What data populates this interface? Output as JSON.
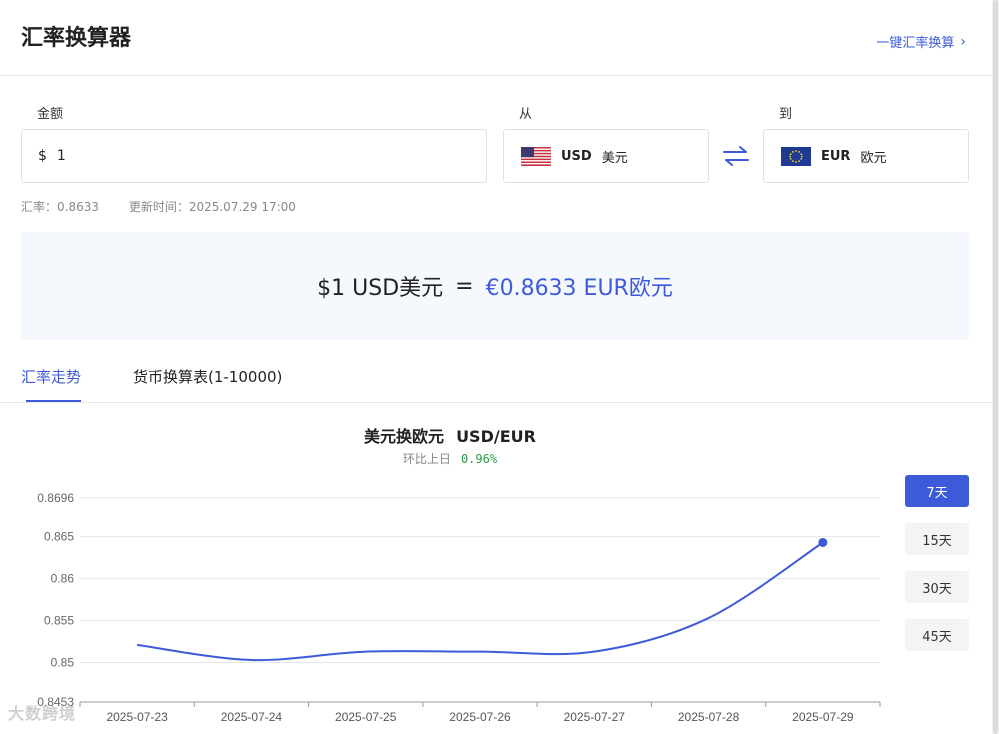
{
  "header": {
    "title": "汇率换算器",
    "quick_link": "一键汇率换算"
  },
  "converter": {
    "amount_label": "金额",
    "from_label": "从",
    "to_label": "到",
    "amount_symbol": "$",
    "amount_value": "1",
    "from": {
      "code": "USD",
      "name": "美元",
      "flag": "us-flag-icon"
    },
    "to": {
      "code": "EUR",
      "name": "欧元",
      "flag": "eu-flag-icon"
    },
    "rate_text": "汇率：0.8633",
    "update_text": "更新时间：2025.07.29 17:00"
  },
  "result": {
    "left": "$1 USD美元",
    "equals": "=",
    "right": "€0.8633 EUR欧元"
  },
  "tabs": [
    {
      "label": "汇率走势",
      "active": true
    },
    {
      "label": "货币换算表(1-10000)",
      "active": false
    }
  ],
  "chart_header": {
    "title": "美元换欧元",
    "pair": "USD/EUR",
    "change_label": "环比上日",
    "change_value": "0.96%"
  },
  "ranges": [
    {
      "label": "7天",
      "active": true
    },
    {
      "label": "15天",
      "active": false
    },
    {
      "label": "30天",
      "active": false
    },
    {
      "label": "45天",
      "active": false
    }
  ],
  "colors": {
    "accent": "#3d5bd9",
    "positive": "#2a9a4a"
  },
  "watermark": "大数跨境",
  "chart_data": {
    "type": "line",
    "x": [
      "2025-07-23",
      "2025-07-24",
      "2025-07-25",
      "2025-07-26",
      "2025-07-27",
      "2025-07-28",
      "2025-07-29"
    ],
    "series": [
      {
        "values": [
          0.8521,
          0.8503,
          0.8513,
          0.8513,
          0.8513,
          0.8553,
          0.8643
        ]
      }
    ],
    "yticks": [
      "0.8453",
      "0.85",
      "0.855",
      "0.86",
      "0.865",
      "0.8696"
    ],
    "ylim": [
      0.8453,
      0.8696
    ],
    "grid": true,
    "xlabel": "",
    "ylabel": ""
  }
}
